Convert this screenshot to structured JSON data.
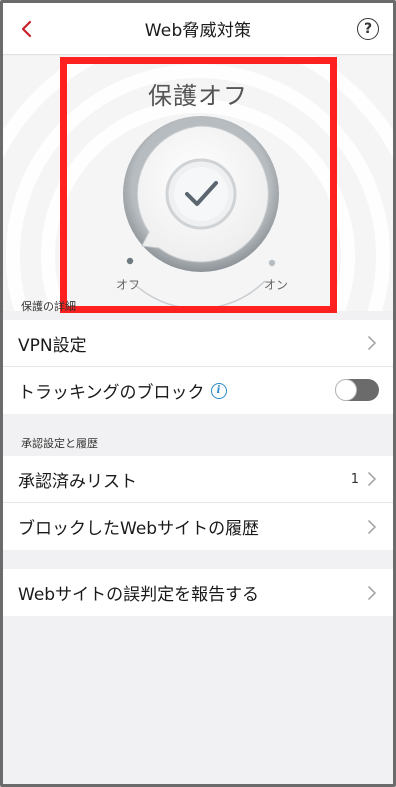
{
  "navbar": {
    "title": "Web脅威対策",
    "back_icon": "chevron-left-icon",
    "help_label": "?"
  },
  "hero": {
    "status": "保護オフ",
    "label_off": "オフ",
    "label_on": "オン",
    "protection_on": false
  },
  "section_protection": {
    "header": "保護の詳細",
    "vpn_label": "VPN設定",
    "tracking_label": "トラッキングのブロック",
    "tracking_info": "i",
    "tracking_enabled": false
  },
  "section_approval": {
    "header": "承認設定と履歴",
    "approved_label": "承認済みリスト",
    "approved_count": "1",
    "blocked_label": "ブロックしたWebサイトの履歴"
  },
  "report": {
    "label": "Webサイトの誤判定を報告する"
  },
  "colors": {
    "accent": "#c8202a",
    "highlight": "#ff2020",
    "info": "#2a8ac8"
  }
}
